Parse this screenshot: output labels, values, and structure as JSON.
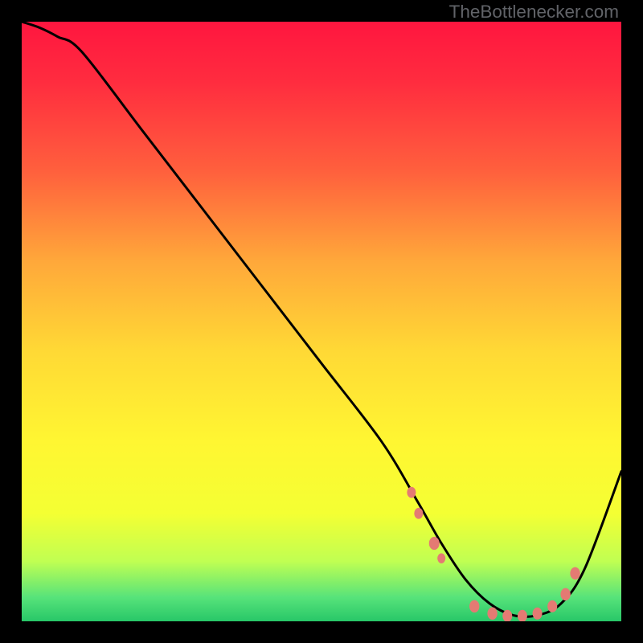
{
  "watermark": "TheBottlenecker.com",
  "chart_data": {
    "type": "line",
    "title": "",
    "xlabel": "",
    "ylabel": "",
    "xlim": [
      0,
      100
    ],
    "ylim": [
      0,
      100
    ],
    "gradient_stops": [
      {
        "offset": 0.0,
        "color": "#ff163f"
      },
      {
        "offset": 0.1,
        "color": "#ff2c3f"
      },
      {
        "offset": 0.25,
        "color": "#ff603d"
      },
      {
        "offset": 0.4,
        "color": "#ffa83a"
      },
      {
        "offset": 0.55,
        "color": "#ffd935"
      },
      {
        "offset": 0.7,
        "color": "#fff632"
      },
      {
        "offset": 0.82,
        "color": "#f4ff33"
      },
      {
        "offset": 0.9,
        "color": "#c0ff52"
      },
      {
        "offset": 0.96,
        "color": "#57e37a"
      },
      {
        "offset": 1.0,
        "color": "#28c768"
      }
    ],
    "series": [
      {
        "name": "bottleneck-curve",
        "x": [
          0,
          3,
          6,
          10,
          20,
          30,
          40,
          50,
          60,
          66,
          70,
          74,
          78,
          82,
          86,
          90,
          94,
          100
        ],
        "y": [
          100,
          99,
          97.5,
          95,
          82,
          69,
          56,
          43,
          30,
          20,
          13,
          7,
          3,
          1,
          1,
          3,
          9,
          25
        ]
      }
    ],
    "markers": {
      "name": "highlight-dots",
      "color": "#e47a73",
      "points": [
        {
          "x": 65.0,
          "y": 21.5,
          "r": 5.5
        },
        {
          "x": 66.2,
          "y": 18.0,
          "r": 5.5
        },
        {
          "x": 68.8,
          "y": 13.0,
          "r": 6.5
        },
        {
          "x": 70.0,
          "y": 10.5,
          "r": 5.0
        },
        {
          "x": 75.5,
          "y": 2.5,
          "r": 6.2
        },
        {
          "x": 78.5,
          "y": 1.3,
          "r": 6.2
        },
        {
          "x": 81.0,
          "y": 0.9,
          "r": 6.0
        },
        {
          "x": 83.5,
          "y": 0.9,
          "r": 6.0
        },
        {
          "x": 86.0,
          "y": 1.3,
          "r": 6.0
        },
        {
          "x": 88.5,
          "y": 2.5,
          "r": 6.0
        },
        {
          "x": 90.7,
          "y": 4.5,
          "r": 6.2
        },
        {
          "x": 92.3,
          "y": 8.0,
          "r": 6.2
        }
      ]
    }
  }
}
